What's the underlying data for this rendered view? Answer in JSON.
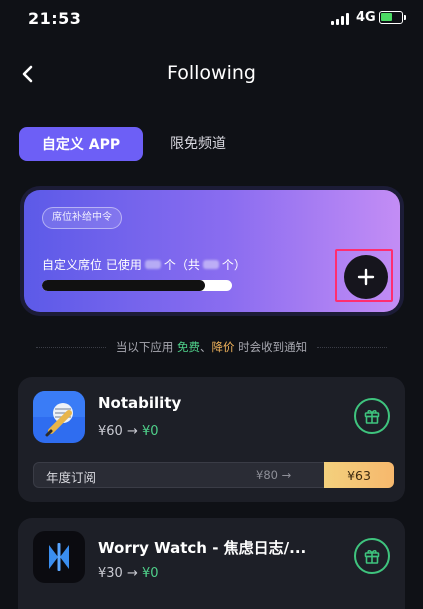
{
  "status_bar": {
    "time": "21:53",
    "network": "4G",
    "battery_color": "#4cd964"
  },
  "header": {
    "back_icon": "chevron-left-icon",
    "title": "Following"
  },
  "tabs": [
    {
      "label": "自定义 APP",
      "active": true
    },
    {
      "label": "限免频道",
      "active": false
    }
  ],
  "slot_card": {
    "badge": "席位补给中令",
    "label_prefix": "自定义席位 已使用",
    "label_mid": "个（共",
    "label_suffix": "个）",
    "used_fraction": 0.86,
    "add_icon": "plus-icon"
  },
  "notice": {
    "prefix": "当以下应用 ",
    "free": "免费",
    "sep": "、",
    "drop": "降价",
    "suffix": " 时会收到通知"
  },
  "apps": [
    {
      "name": "Notability",
      "old_price": "¥60 →",
      "new_price": "¥0",
      "subscription": {
        "label": "年度订阅",
        "old_price": "¥80 →",
        "new_price": "¥63"
      },
      "icon": "notability-app-icon"
    },
    {
      "name": "Worry Watch - 焦虑日志/...",
      "old_price": "¥30 →",
      "new_price": "¥0",
      "icon": "worry-watch-app-icon"
    }
  ],
  "colors": {
    "accent": "#6d5ff6",
    "green": "#4fd08a",
    "orange": "#f2b45c",
    "highlight": "#ff2d6f"
  }
}
